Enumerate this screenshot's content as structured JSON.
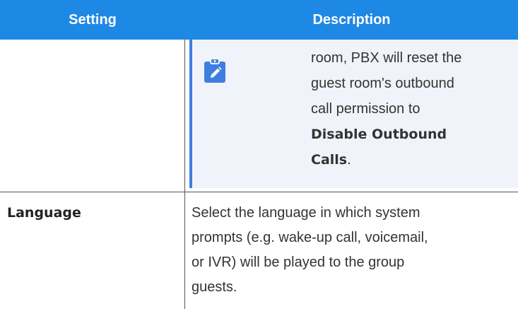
{
  "header": {
    "setting_label": "Setting",
    "description_label": "Description"
  },
  "note": {
    "icon": "edit-note-icon",
    "lines": [
      "room, PBX will reset the",
      "guest room's outbound",
      "call permission to"
    ],
    "bold_line1": "Disable Outbound",
    "bold_line2": "Calls",
    "end_punct": "."
  },
  "row": {
    "setting": "Language",
    "description_lines": [
      "Select the language in which system",
      "prompts (e.g. wake-up call, voicemail,",
      "or IVR) will be played to the group",
      "guests."
    ]
  },
  "colors": {
    "header_bg": "#1e88e5",
    "note_bg": "#f0f4fa",
    "note_accent": "#3d7fe0"
  }
}
